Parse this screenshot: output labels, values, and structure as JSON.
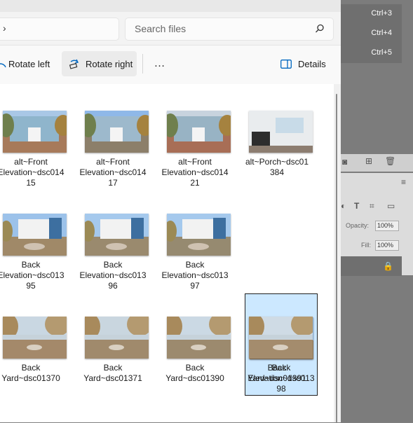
{
  "search": {
    "placeholder": "Search files"
  },
  "toolbar": {
    "rotate_left": "Rotate left",
    "rotate_right": "Rotate right",
    "more": "…",
    "details": "Details"
  },
  "photoshop": {
    "menu": [
      "Ctrl+3",
      "Ctrl+4",
      "Ctrl+5"
    ],
    "opacity_label": "Opacity:",
    "opacity_value": "100%",
    "fill_label": "Fill:",
    "fill_value": "100%"
  },
  "files": [
    {
      "name": "alt~Front\nElevation~dsc014\n15",
      "icons": "front-house",
      "colors": {
        "sky": "#a9c7e6",
        "ground": "#a77a5a",
        "house": "#8fb5cc"
      }
    },
    {
      "name": "alt~Front\nElevation~dsc014\n17",
      "icons": "front-house",
      "colors": {
        "sky": "#8fb8e8",
        "ground": "#8c7f6a",
        "house": "#9db9cc"
      }
    },
    {
      "name": "alt~Front\nElevation~dsc014\n21",
      "icons": "front-house",
      "colors": {
        "sky": "#c8d3de",
        "ground": "#a86e56",
        "house": "#98b3c4"
      }
    },
    {
      "name": "alt~Porch~dsc01\n384",
      "icons": "porch",
      "colors": {
        "sky": "#dfe6ea",
        "ground": "#7a746e",
        "house": "#e9ecee"
      }
    },
    {
      "name": "Back\nElevation~dsc013\n95",
      "icons": "back-house",
      "colors": {
        "sky": "#9cc2ea",
        "ground": "#a08968",
        "house": "#f2f2f2"
      }
    },
    {
      "name": "Back\nElevation~dsc013\n96",
      "icons": "back-house",
      "colors": {
        "sky": "#a5c9ed",
        "ground": "#9a8a6e",
        "house": "#f2f2f2"
      }
    },
    {
      "name": "Back\nElevation~dsc013\n97",
      "icons": "back-house",
      "colors": {
        "sky": "#a5c9ed",
        "ground": "#968a70",
        "house": "#f2f2f2"
      }
    },
    {
      "name": "Back\nElevation~dsc013\n98",
      "icons": "back-house",
      "selected": true,
      "colors": {
        "sky": "#9cc4ee",
        "ground": "#9b8465",
        "house": "#f0f0f0"
      }
    },
    {
      "name": "Back\nYard~dsc01370",
      "icons": "yard",
      "colors": {
        "sky": "#c9d7e2",
        "ground": "#a4896a",
        "house": "#b69a76"
      }
    },
    {
      "name": "Back\nYard~dsc01371",
      "icons": "yard",
      "colors": {
        "sky": "#c9d6df",
        "ground": "#a08a6c",
        "house": "#b9a07e"
      }
    },
    {
      "name": "Back\nYard~dsc01390",
      "icons": "yard",
      "colors": {
        "sky": "#cbd9e4",
        "ground": "#9c8a6e",
        "house": "#a9906e"
      }
    },
    {
      "name": "Back\nYard~dsc01391",
      "icons": "yard",
      "colors": {
        "sky": "#cfdbe5",
        "ground": "#a48c6d",
        "house": "#b09675"
      }
    }
  ]
}
